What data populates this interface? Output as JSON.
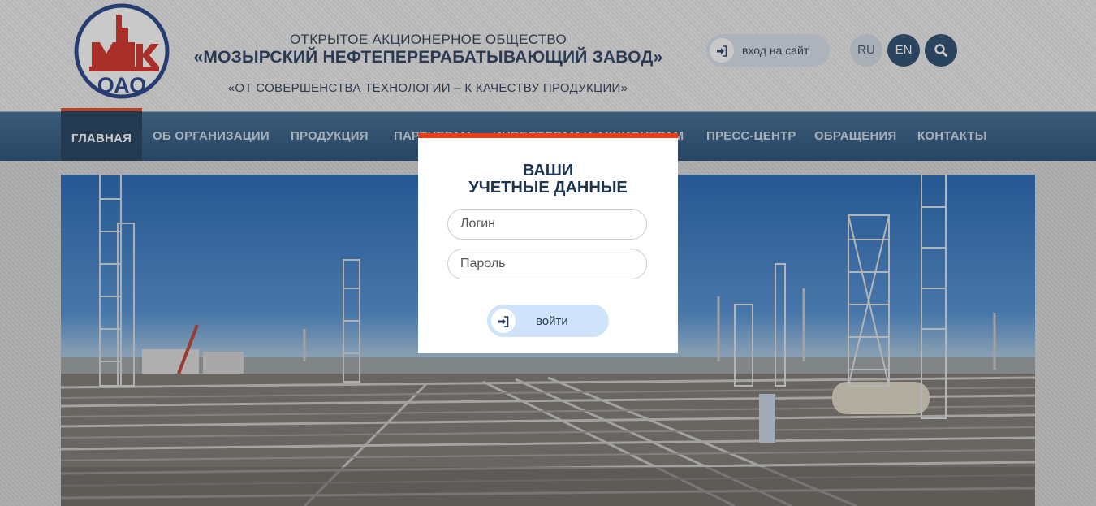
{
  "header": {
    "logo_text": "МНПЗ ОАО",
    "org_line1": "ОТКРЫТОЕ АКЦИОНЕРНОЕ ОБЩЕСТВО",
    "org_line2": "«МОЗЫРСКИЙ НЕФТЕПЕРЕРАБАТЫВАЮЩИЙ ЗАВОД»",
    "slogan": "«ОТ СОВЕРШЕНСТВА ТЕХНОЛОГИИ – К КАЧЕСТВУ ПРОДУКЦИИ»",
    "login_link": "вход на сайт",
    "lang_ru": "RU",
    "lang_en": "EN",
    "icons": {
      "login": "sign-in-icon",
      "search": "search-icon"
    }
  },
  "nav": {
    "items": [
      {
        "label": "ГЛАВНАЯ",
        "active": true
      },
      {
        "label": "ОБ ОРГАНИЗАЦИИ"
      },
      {
        "label": "ПРОДУКЦИЯ"
      },
      {
        "label": "ПАРТНЕРАМ"
      },
      {
        "label": "ИНВЕСТОРАМ И АКЦИОНЕРАМ"
      },
      {
        "label": "ПРЕСС-ЦЕНТР"
      },
      {
        "label": "ОБРАЩЕНИЯ"
      },
      {
        "label": "КОНТАКТЫ"
      }
    ]
  },
  "modal": {
    "title_line1": "ВАШИ",
    "title_line2": "УЧЕТНЫЕ ДАННЫЕ",
    "login_placeholder": "Логин",
    "password_placeholder": "Пароль",
    "submit_label": "войти",
    "accent_color": "#ea3f16"
  },
  "colors": {
    "brand_blue": "#23476c",
    "nav_active_accent": "#e1481f"
  }
}
